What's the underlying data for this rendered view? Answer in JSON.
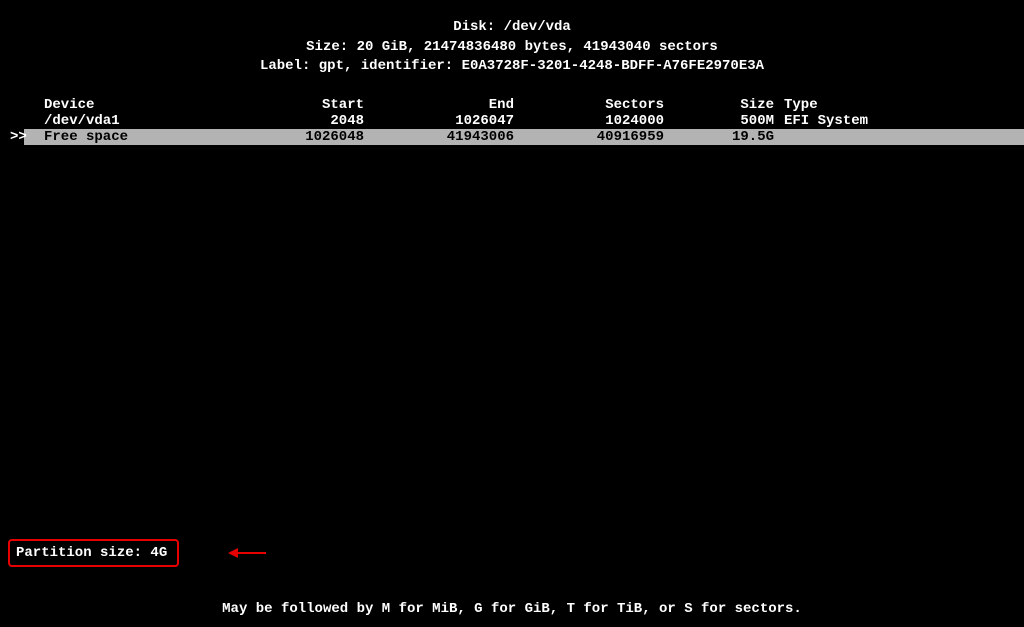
{
  "header": {
    "line1": "Disk: /dev/vda",
    "line2": "Size: 20 GiB, 21474836480 bytes, 41943040 sectors",
    "line3": "Label: gpt, identifier: E0A3728F-3201-4248-BDFF-A76FE2970E3A"
  },
  "table": {
    "columns": {
      "device": "Device",
      "start": "Start",
      "end": "End",
      "sectors": "Sectors",
      "size": "Size",
      "type": "Type"
    },
    "rows": [
      {
        "selector": "",
        "device": "/dev/vda1",
        "start": "2048",
        "end": "1026047",
        "sectors": "1024000",
        "size": "500M",
        "type": "EFI System",
        "selected": false
      },
      {
        "selector": ">>",
        "device": "Free space",
        "start": "1026048",
        "end": "41943006",
        "sectors": "40916959",
        "size": "19.5G",
        "type": "",
        "selected": true
      }
    ]
  },
  "input": {
    "label": "Partition size: ",
    "value": "4G"
  },
  "footer": {
    "hint": "May be followed by M for MiB, G for GiB, T for TiB, or S for sectors."
  }
}
